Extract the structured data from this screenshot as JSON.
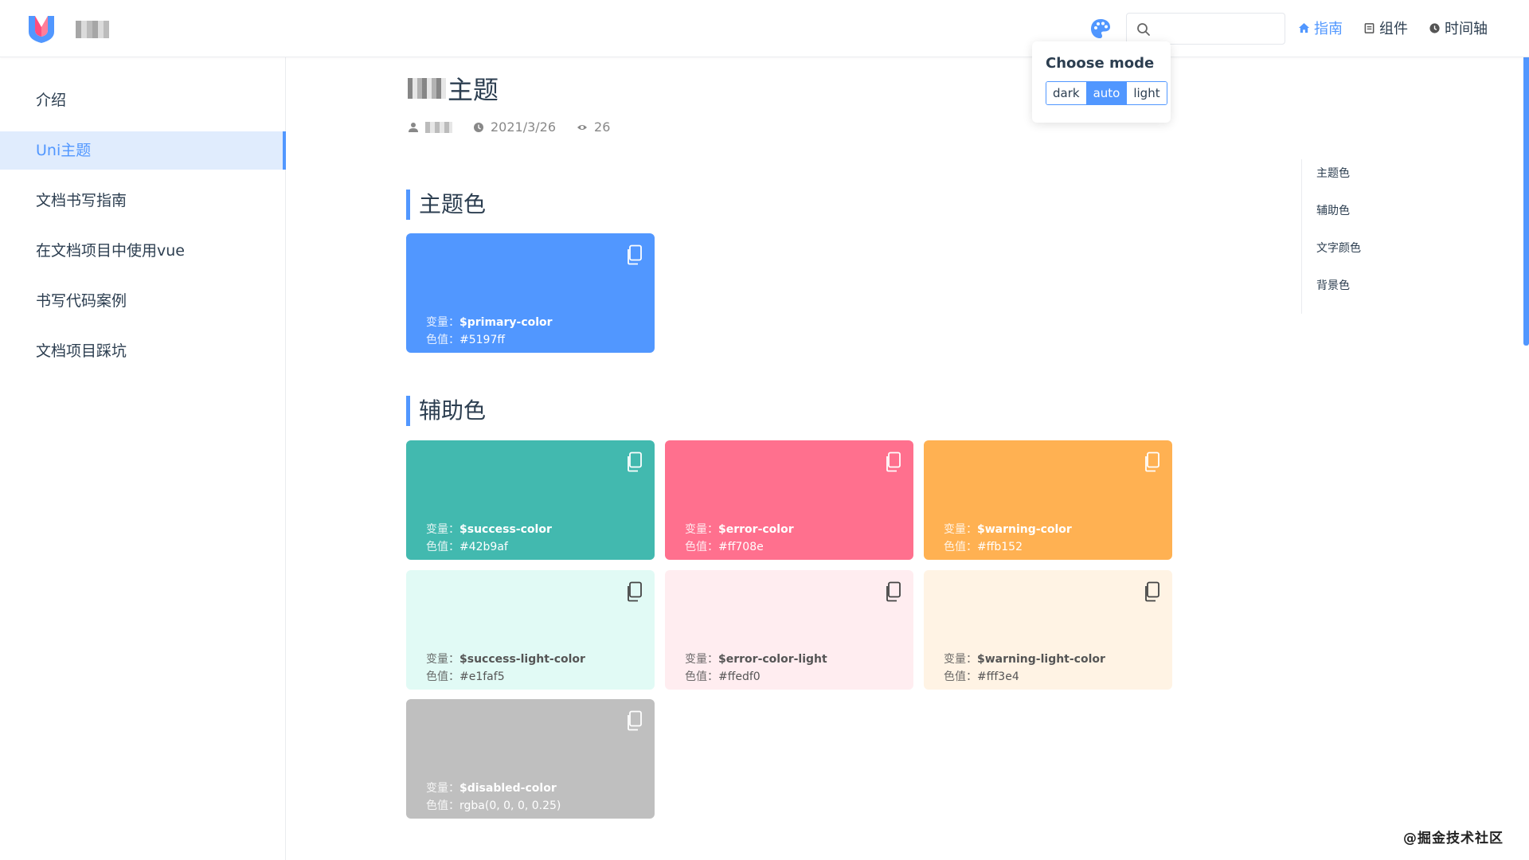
{
  "nav": {
    "search_value": "",
    "links": [
      {
        "label": "指南",
        "icon": "home-icon",
        "active": true
      },
      {
        "label": "组件",
        "icon": "book-icon",
        "active": false
      },
      {
        "label": "时间轴",
        "icon": "clock-icon",
        "active": false
      }
    ]
  },
  "mode_popup": {
    "title": "Choose mode",
    "options": [
      "dark",
      "auto",
      "light"
    ],
    "selected": "auto"
  },
  "sidebar": {
    "items": [
      {
        "label": "介绍",
        "active": false
      },
      {
        "label": "Uni主题",
        "active": true
      },
      {
        "label": "文档书写指南",
        "active": false
      },
      {
        "label": "在文档项目中使用vue",
        "active": false
      },
      {
        "label": "书写代码案例",
        "active": false
      },
      {
        "label": "文档项目踩坑",
        "active": false
      }
    ]
  },
  "page": {
    "title": "主题",
    "date": "2021/3/26",
    "views": "26"
  },
  "sections": {
    "primary_title": "主题色",
    "aux_title": "辅助色"
  },
  "cards": {
    "var_key": "变量：",
    "val_key": "色值：",
    "primary": {
      "var": "$primary-color",
      "value": "#5197ff",
      "color": "#5197ff"
    },
    "success": {
      "var": "$success-color",
      "value": "#42b9af",
      "color": "#42b9af"
    },
    "error": {
      "var": "$error-color",
      "value": "#ff708e",
      "color": "#ff708e"
    },
    "warning": {
      "var": "$warning-color",
      "value": "#ffb152",
      "color": "#ffb152"
    },
    "success_light": {
      "var": "$success-light-color",
      "value": "#e1faf5",
      "color": "#e1faf5"
    },
    "error_light": {
      "var": "$error-color-light",
      "value": "#ffedf0",
      "color": "#ffedf0"
    },
    "warning_light": {
      "var": "$warning-light-color",
      "value": "#fff3e4",
      "color": "#fff3e4"
    },
    "disabled": {
      "var": "$disabled-color",
      "value": "rgba(0, 0, 0, 0.25)",
      "color": "#bfbfbf"
    }
  },
  "toc": [
    "主题色",
    "辅助色",
    "文字颜色",
    "背景色"
  ],
  "watermark": "@掘金技术社区",
  "colors": {
    "accent": "#5197ff",
    "active_bg": "#e0ecfd"
  }
}
